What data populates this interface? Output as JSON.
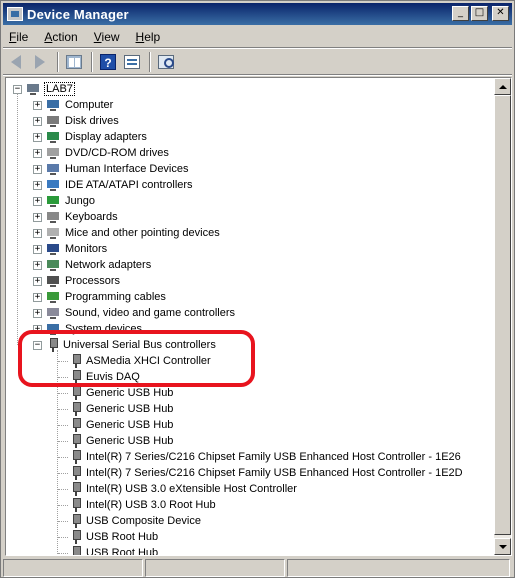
{
  "window": {
    "title": "Device Manager",
    "buttons": {
      "minimize": "_",
      "maximize": "□",
      "close": "✕"
    }
  },
  "menu": [
    {
      "label": "File",
      "key": "F",
      "rest": "ile"
    },
    {
      "label": "Action",
      "key": "A",
      "rest": "ction"
    },
    {
      "label": "View",
      "key": "V",
      "rest": "iew"
    },
    {
      "label": "Help",
      "key": "H",
      "rest": "elp"
    }
  ],
  "toolbar": [
    "back-icon",
    "forward-icon",
    "show-hide-console-tree-icon",
    "help-icon",
    "properties-icon",
    "scan-hardware-icon"
  ],
  "tree": {
    "root": "LAB7",
    "categories": [
      {
        "label": "Computer",
        "icon": "computer-icon"
      },
      {
        "label": "Disk drives",
        "icon": "disk-drive-icon"
      },
      {
        "label": "Display adapters",
        "icon": "display-adapter-icon"
      },
      {
        "label": "DVD/CD-ROM drives",
        "icon": "dvd-drive-icon"
      },
      {
        "label": "Human Interface Devices",
        "icon": "hid-icon"
      },
      {
        "label": "IDE ATA/ATAPI controllers",
        "icon": "ide-controller-icon"
      },
      {
        "label": "Jungo",
        "icon": "jungo-icon"
      },
      {
        "label": "Keyboards",
        "icon": "keyboard-icon"
      },
      {
        "label": "Mice and other pointing devices",
        "icon": "mouse-icon"
      },
      {
        "label": "Monitors",
        "icon": "monitor-icon"
      },
      {
        "label": "Network adapters",
        "icon": "network-adapter-icon"
      },
      {
        "label": "Processors",
        "icon": "processor-icon"
      },
      {
        "label": "Programming cables",
        "icon": "cable-icon"
      },
      {
        "label": "Sound, video and game controllers",
        "icon": "sound-icon"
      },
      {
        "label": "System devices",
        "icon": "system-devices-icon"
      }
    ],
    "usb": {
      "label": "Universal Serial Bus controllers",
      "children": [
        "ASMedia XHCI Controller",
        "Euvis DAQ",
        "Generic USB Hub",
        "Generic USB Hub",
        "Generic USB Hub",
        "Generic USB Hub",
        "Intel(R) 7 Series/C216 Chipset Family USB Enhanced Host Controller - 1E26",
        "Intel(R) 7 Series/C216 Chipset Family USB Enhanced Host Controller - 1E2D",
        "Intel(R) USB 3.0 eXtensible Host Controller",
        "Intel(R) USB 3.0 Root Hub",
        "USB Composite Device",
        "USB Root Hub",
        "USB Root Hub"
      ]
    },
    "expand_symbol": "+",
    "collapse_symbol": "−"
  },
  "colors": {
    "highlight": "#e8141e",
    "titlebar": "#0a246a"
  }
}
